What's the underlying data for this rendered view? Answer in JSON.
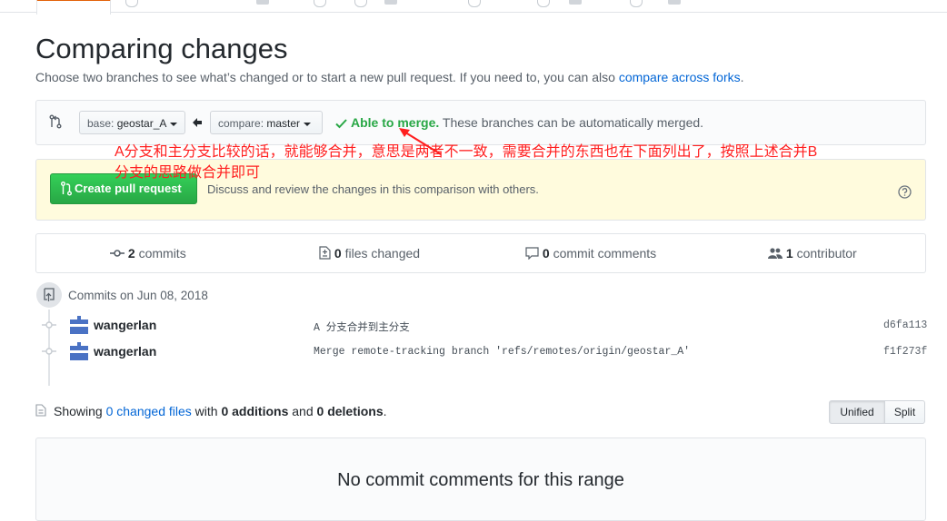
{
  "header": {
    "title": "Comparing changes",
    "subtitle": "Choose two branches to see what’s changed or to start a new pull request. If you need to, you can also ",
    "subtitle_link": "compare across forks",
    "subtitle_end": "."
  },
  "range": {
    "base_prefix": "base:",
    "base_value": "geostar_A",
    "compare_prefix": "compare:",
    "compare_value": "master",
    "merge_status": "Able to merge.",
    "merge_note": "These branches can be automatically merged."
  },
  "pull_request": {
    "button_label": "Create pull request",
    "description": "Discuss and review the changes in this comparison with others."
  },
  "stats": {
    "commits_count": "2",
    "commits_label": "commits",
    "files_count": "0",
    "files_label": "files changed",
    "comments_count": "0",
    "comments_label": "commit comments",
    "contributors_count": "1",
    "contributors_label": "contributor"
  },
  "commits": {
    "group_label": "Commits on Jun 08, 2018",
    "rows": [
      {
        "author": "wangerlan",
        "message": "A 分支合并到主分支",
        "sha": "d6fa113"
      },
      {
        "author": "wangerlan",
        "message": "Merge remote-tracking branch 'refs/remotes/origin/geostar_A'",
        "sha": "f1f273f"
      }
    ]
  },
  "diff_summary": {
    "showing": "Showing",
    "changed_link": "0 changed files",
    "with": "with",
    "additions": "0 additions",
    "and": "and",
    "deletions": "0 deletions",
    "end": ".",
    "unified_label": "Unified",
    "split_label": "Split"
  },
  "no_comments": "No commit comments for this range",
  "annotation": {
    "line1": "A分支和主分支比较的话，就能够合并，意思是两者不一致，需要合并的东西也在下面列出了，按照上述合并B",
    "line2": "分支的思路做合并即可"
  },
  "colors": {
    "link": "#0366d6",
    "merge_green": "#28a745",
    "annotation_red": "#ff1f1f",
    "pr_box_bg": "#fffbdd"
  },
  "icons": {
    "compare": "compare-icon",
    "arrow_left": "arrow-left-icon",
    "check": "check-icon",
    "pull_request": "git-pull-request-icon",
    "question": "question-icon",
    "commit": "git-commit-icon",
    "file_diff": "file-diff-icon",
    "comment": "comment-icon",
    "people": "people-icon",
    "repo_push": "repo-push-icon",
    "file": "file-icon"
  }
}
